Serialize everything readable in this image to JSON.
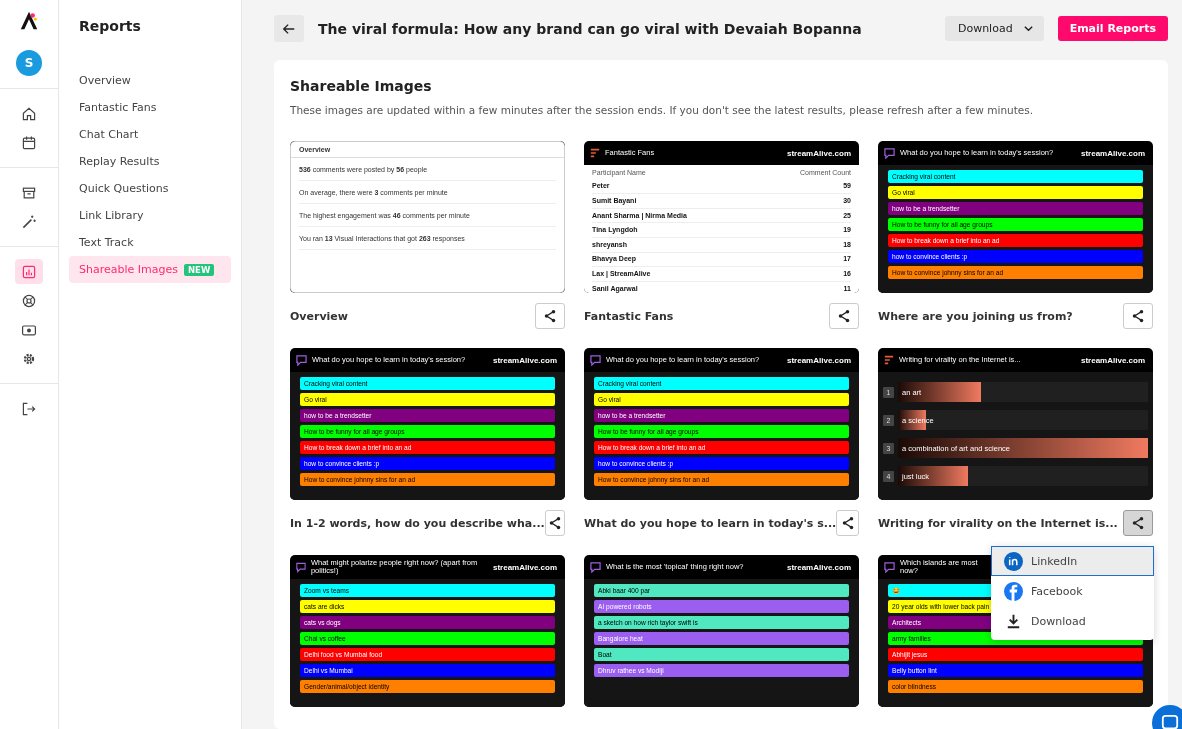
{
  "rail": {
    "avatar": "S",
    "items": [
      {
        "selected": false
      },
      {
        "selected": false
      },
      {
        "selected": false
      },
      {
        "selected": false
      },
      {
        "selected": true
      },
      {
        "selected": false
      },
      {
        "selected": false
      },
      {
        "selected": false
      },
      {
        "selected": false
      }
    ]
  },
  "sidebar": {
    "title": "Reports",
    "items": [
      {
        "label": "Overview",
        "selected": false
      },
      {
        "label": "Fantastic Fans",
        "selected": false
      },
      {
        "label": "Chat Chart",
        "selected": false
      },
      {
        "label": "Replay Results",
        "selected": false
      },
      {
        "label": "Quick Questions",
        "selected": false
      },
      {
        "label": "Link Library",
        "selected": false
      },
      {
        "label": "Text Track",
        "selected": false
      },
      {
        "label": "Shareable Images",
        "selected": true,
        "badge": "NEW"
      }
    ]
  },
  "header": {
    "title": "The viral formula: How any brand can go viral with Devaiah Bopanna",
    "download": "Download",
    "email": "Email Reports"
  },
  "section": {
    "title": "Shareable Images",
    "description": "These images are updated within a few minutes after the session ends. If you don't see the latest results, please refresh after a few minutes."
  },
  "cards": [
    {
      "label": "Overview",
      "share_selected": false,
      "image": {
        "kind": "overview",
        "title": "Overview",
        "lines": [
          "**536** comments were posted by **56** people",
          "On average, there were **3** comments per minute",
          "The highest engagement was **46** comments per minute",
          "You ran **13** Visual Interactions that got **263** responses"
        ]
      }
    },
    {
      "label": "Fantastic Fans",
      "share_selected": false,
      "image": {
        "kind": "table",
        "title": "Fantastic Fans",
        "brand": "streamAlive.com",
        "columns": [
          "Participant Name",
          "Comment Count"
        ],
        "rows": [
          [
            "Peter",
            "59"
          ],
          [
            "Sumit Bayani",
            "30"
          ],
          [
            "Anant Sharma | Nirma Media",
            "25"
          ],
          [
            "Tina Lyngdoh",
            "19"
          ],
          [
            "shreyansh",
            "18"
          ],
          [
            "Bhavya Deep",
            "17"
          ],
          [
            "Lax | StreamAlive",
            "16"
          ],
          [
            "Sanil Agarwal",
            "11"
          ]
        ]
      }
    },
    {
      "label": "Where are you joining us from?",
      "share_selected": false,
      "image": {
        "kind": "poll",
        "title": "What do you hope to learn in today's session?",
        "brand": "streamAlive.com",
        "options": [
          {
            "text": "Cracking viral content",
            "color": "#00ffff"
          },
          {
            "text": "Go viral",
            "color": "#ffff00"
          },
          {
            "text": "how to be a trendsetter",
            "color": "#800080"
          },
          {
            "text": "How to be funny for all age groups",
            "color": "#00ff00"
          },
          {
            "text": "How to break down a brief into an ad",
            "color": "#ff0000"
          },
          {
            "text": "how to convince clients :p",
            "color": "#0000ff"
          },
          {
            "text": "How to convince johnny sins for an ad",
            "color": "#ff8000"
          }
        ]
      }
    },
    {
      "label": "In 1-2 words, how do you describe wha...",
      "share_selected": false,
      "image": {
        "kind": "poll",
        "title": "What do you hope to learn in today's session?",
        "brand": "streamAlive.com",
        "options": [
          {
            "text": "Cracking viral content",
            "color": "#00ffff"
          },
          {
            "text": "Go viral",
            "color": "#ffff00"
          },
          {
            "text": "how to be a trendsetter",
            "color": "#800080"
          },
          {
            "text": "How to be funny for all age groups",
            "color": "#00ff00"
          },
          {
            "text": "How to break down a brief into an ad",
            "color": "#ff0000"
          },
          {
            "text": "how to convince clients :p",
            "color": "#0000ff"
          },
          {
            "text": "How to convince johnny sins for an ad",
            "color": "#ff8000"
          }
        ]
      }
    },
    {
      "label": "What do you hope to learn in today's s...",
      "share_selected": false,
      "image": {
        "kind": "poll",
        "title": "What do you hope to learn in today's session?",
        "brand": "streamAlive.com",
        "options": [
          {
            "text": "Cracking viral content",
            "color": "#00ffff"
          },
          {
            "text": "Go viral",
            "color": "#ffff00"
          },
          {
            "text": "how to be a trendsetter",
            "color": "#800080"
          },
          {
            "text": "How to be funny for all age groups",
            "color": "#00ff00"
          },
          {
            "text": "How to break down a brief into an ad",
            "color": "#ff0000"
          },
          {
            "text": "how to convince clients :p",
            "color": "#0000ff"
          },
          {
            "text": "How to convince johnny sins for an ad",
            "color": "#ff8000"
          }
        ]
      }
    },
    {
      "label": "Writing for virality on the Internet is...",
      "share_selected": true,
      "image": {
        "kind": "ranking",
        "title": "Writing for virality on the Internet is...",
        "brand": "streamAlive.com",
        "items": [
          {
            "rank": "1",
            "text": "an art",
            "level": 0.33
          },
          {
            "rank": "2",
            "text": "a science",
            "level": 0.11
          },
          {
            "rank": "3",
            "text": "a combination of art and science",
            "level": 1
          },
          {
            "rank": "4",
            "text": "just luck",
            "level": 0.28
          }
        ]
      }
    },
    {
      "image": {
        "kind": "poll",
        "title": "What might polarize people right now? (apart from politics!)",
        "brand": "streamAlive.com",
        "options": [
          {
            "text": "Zoom vs teams",
            "color": "#00ffff"
          },
          {
            "text": "cats are dicks",
            "color": "#ffff00"
          },
          {
            "text": "cats vs dogs",
            "color": "#800080"
          },
          {
            "text": "Chai vs coffee",
            "color": "#00ff00"
          },
          {
            "text": "Delhi food vs Mumbai food",
            "color": "#ff0000"
          },
          {
            "text": "Delhi vs Mumbai",
            "color": "#0000ff"
          },
          {
            "text": "Gender/animal/object identity",
            "color": "#ff8000"
          }
        ]
      }
    },
    {
      "image": {
        "kind": "poll",
        "title": "What is the most 'topical' thing right now?",
        "brand": "streamAlive.com",
        "options": [
          {
            "text": "Abki baar 400 par",
            "color": "#50e8c0"
          },
          {
            "text": "AI powered robots",
            "color": "#9a5ff0"
          },
          {
            "text": "a sketch on how rich taylor swift is",
            "color": "#50e8c0"
          },
          {
            "text": "Bangalore heat",
            "color": "#9a5ff0"
          },
          {
            "text": "Boat",
            "color": "#50e8c0"
          },
          {
            "text": "Dhruv rathee vs Modiji",
            "color": "#9a5ff0"
          }
        ]
      }
    },
    {
      "image": {
        "kind": "poll",
        "title": "Which islands are most\nnow?",
        "options": [
          {
            "text": "😂",
            "color": "#00ffff"
          },
          {
            "text": "20 year olds with lower back pain",
            "color": "#ffff00"
          },
          {
            "text": "Architects",
            "color": "#800080"
          },
          {
            "text": "army families",
            "color": "#00ff00"
          },
          {
            "text": "Abhijit jesus",
            "color": "#ff0000"
          },
          {
            "text": "Belly button lint",
            "color": "#0000ff"
          },
          {
            "text": "color blindness",
            "color": "#ff8000"
          }
        ]
      }
    }
  ],
  "share_menu": [
    {
      "label": "LinkedIn",
      "selected": true
    },
    {
      "label": "Facebook",
      "selected": false
    },
    {
      "label": "Download",
      "selected": false
    }
  ]
}
